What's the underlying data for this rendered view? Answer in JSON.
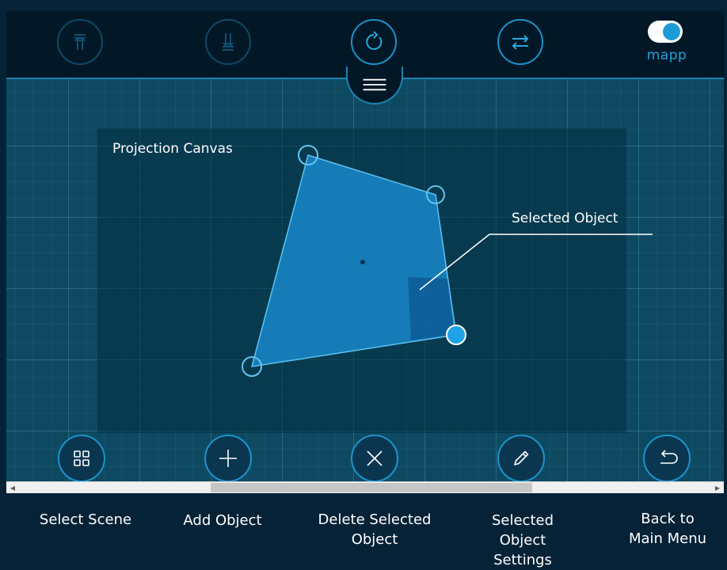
{
  "toolbar": {
    "buttons": [
      {
        "icon": "align-top-icon",
        "enabled": false
      },
      {
        "icon": "align-bottom-icon",
        "enabled": false
      },
      {
        "icon": "rotate-icon",
        "enabled": true
      },
      {
        "icon": "swap-icon",
        "enabled": true
      }
    ],
    "toggle": {
      "label": "mapp",
      "on": true
    },
    "menu_icon": "hamburger-icon"
  },
  "canvas": {
    "projection_label": "Projection Canvas",
    "selected_label": "Selected Object"
  },
  "actions": [
    {
      "icon": "grid-icon",
      "label": "Select Scene"
    },
    {
      "icon": "plus-icon",
      "label": "Add Object"
    },
    {
      "icon": "close-icon",
      "label": "Delete Selected\nObject"
    },
    {
      "icon": "pencil-icon",
      "label": "Selected\nObject\nSettings"
    },
    {
      "icon": "back-arrow-icon",
      "label": "Back to\nMain Menu"
    }
  ],
  "colors": {
    "accent": "#1b93cc",
    "shape_fill": "#1a8fd6",
    "background": "#062236"
  }
}
